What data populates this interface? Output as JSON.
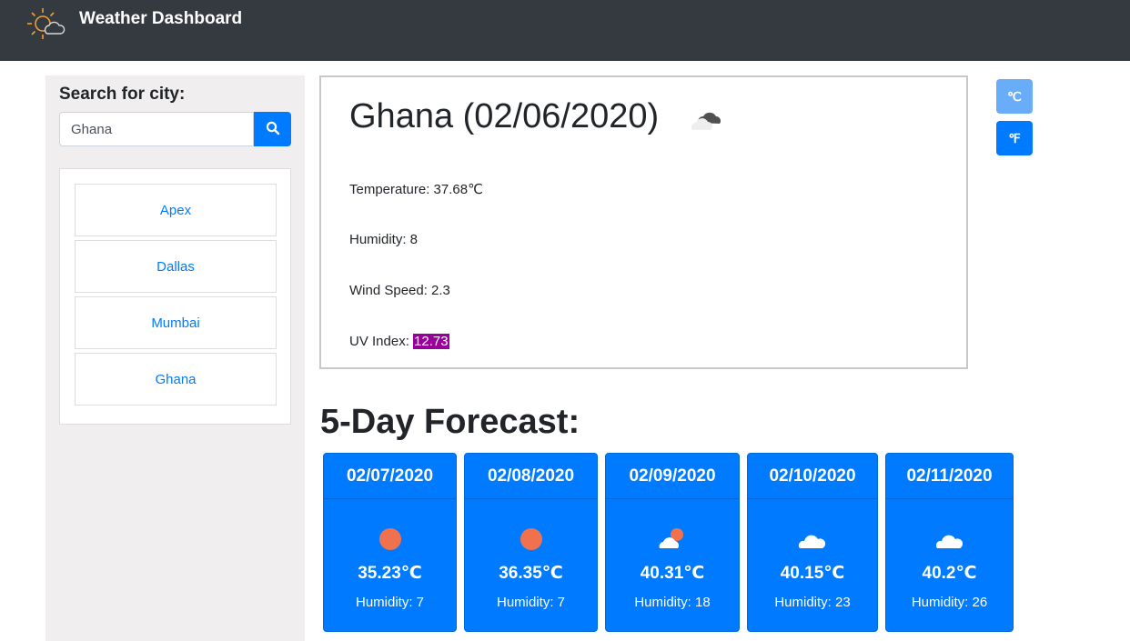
{
  "navbar": {
    "title": "Weather Dashboard",
    "logo_icon": "sun-cloud-logo"
  },
  "sidebar": {
    "search_label": "Search for city:",
    "search_value": "Ghana",
    "search_icon": "search-icon",
    "history": [
      "Apex",
      "Dallas",
      "Mumbai",
      "Ghana"
    ]
  },
  "current": {
    "title": "Ghana (02/06/2020)",
    "icon": "broken-clouds-icon",
    "temperature": "Temperature: 37.68℃",
    "humidity": "Humidity: 8",
    "wind": "Wind Speed: 2.3",
    "uv_label": "UV Index: ",
    "uv_value": "12.73",
    "uv_color": "#990099"
  },
  "units": {
    "celsius": "℃",
    "fahrenheit": "℉"
  },
  "forecast": {
    "heading": "5-Day Forecast:",
    "days": [
      {
        "date": "02/07/2020",
        "icon": "sun-icon",
        "temp": "35.23℃",
        "humidity": "Humidity: 7"
      },
      {
        "date": "02/08/2020",
        "icon": "sun-icon",
        "temp": "36.35℃",
        "humidity": "Humidity: 7"
      },
      {
        "date": "02/09/2020",
        "icon": "partly-cloudy-icon",
        "temp": "40.31℃",
        "humidity": "Humidity: 18"
      },
      {
        "date": "02/10/2020",
        "icon": "cloud-icon",
        "temp": "40.15℃",
        "humidity": "Humidity: 23"
      },
      {
        "date": "02/11/2020",
        "icon": "cloud-icon",
        "temp": "40.2℃",
        "humidity": "Humidity: 26"
      }
    ]
  },
  "colors": {
    "navbar": "#343a40",
    "primary": "#007bff",
    "sidebar_bg": "#f0eeee",
    "sun": "#f0714e"
  }
}
